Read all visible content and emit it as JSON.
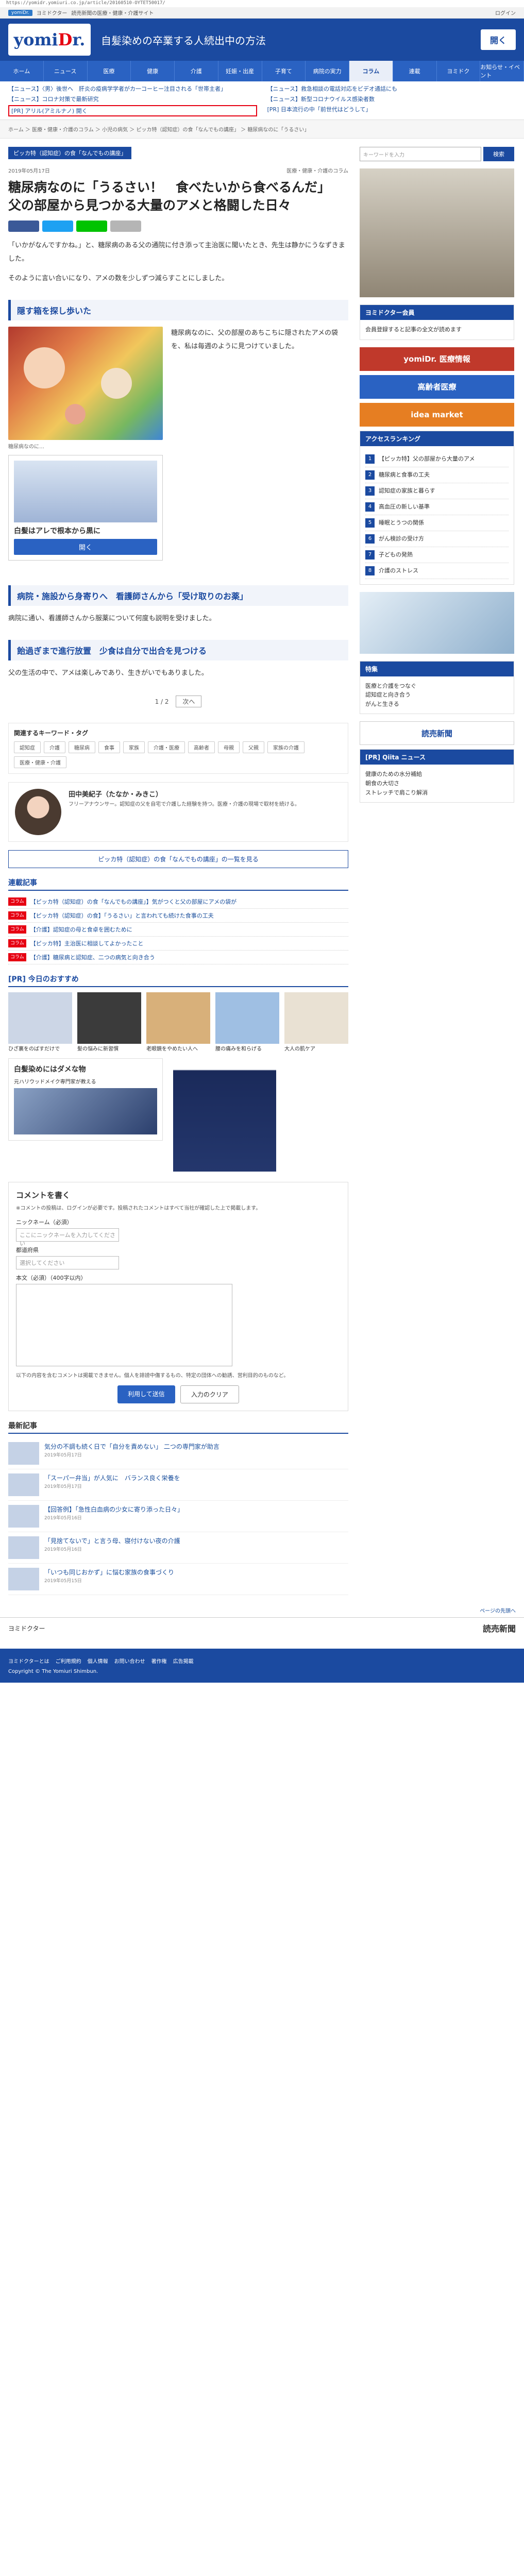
{
  "url": "https://yomidr.yomiuri.co.jp/article/20160510-OYTET50017/",
  "topbar": {
    "items": [
      "yomiDr.",
      "ヨミドクター",
      "読売新聞の医療・健康・介護サイト"
    ],
    "login": "ログイン"
  },
  "header": {
    "subtitle": "自髪染めの卒業する人続出中の方法",
    "button": "開く"
  },
  "nav": [
    "ホーム",
    "ニュース",
    "医療",
    "健康",
    "介護",
    "妊娠・出産",
    "子育て",
    "病院の実力",
    "コラム",
    "連載",
    "ヨミドク",
    "お知らせ・イベント"
  ],
  "news": [
    "【ニュース】〈男〉後世へ　肝炎の疫病学学者がカ一コーヒー注目される「世帯主者」",
    "【ニュース】救急相談の電話対応をビデオ通話にも",
    "【ニュース】コロナ対策で最新研究",
    "【ニュース】新型コロナウイルス感染者数",
    "[PR] アリル(アミルナノ) 開く",
    "[PR] 日本流行の中「前世代はどうして」"
  ],
  "breadcrumb": "ホーム ＞ 医療・健康・介護のコラム ＞ 小児の病気 ＞ ピッカ特（認知症）の食「なんでもの講座」 ＞ 糖尿病なのに「うるさい」",
  "article": {
    "category": "ピッカ特（認知症）の食「なんでもの講座」",
    "date": "2019年05月17日",
    "tags": "医療・健康・介護のコラム",
    "title": "糖尿病なのに「うるさい！　食べたいから食べるんだ」　父の部屋から見つかる大量のアメと格闘した日々",
    "paragraphs": [
      "「いかがなんですかね。」と、糖尿病のある父の通院に付き添って主治医に聞いたとき、先生は静かにうなずきました。",
      "そのように言い合いになり、アメの数を少しずつ減らすことにしました。"
    ],
    "sections": [
      {
        "heading": "隠す箱を探し歩いた",
        "text": "糖尿病なのに、父の部屋のあちこちに隠されたアメの袋を、私は毎週のように見つけていました。"
      },
      {
        "heading": "病院・施設から身寄りへ　看護師さんから「受け取りのお薬」",
        "text": "病院に通い、看護師さんから服薬について何度も説明を受けました。"
      },
      {
        "heading": "飴過ぎまで進行放置　少食は自分で出合を見つける",
        "text": "父の生活の中で、アメは楽しみであり、生きがいでもありました。"
      }
    ],
    "image_caption": "糖尿病なのに…",
    "ad": {
      "title": "白髪はアレで根本から黒に",
      "button": "開く"
    },
    "pager": "1 / 2",
    "next": "次へ"
  },
  "tags": {
    "heading": "関連するキーワード・タグ",
    "items": [
      "認知症",
      "介護",
      "糖尿病",
      "食事",
      "家族",
      "介護・医療",
      "高齢者",
      "母親",
      "父親",
      "家族の介護",
      "医療・健康・介護"
    ]
  },
  "author": {
    "name": "田中美紀子（たなか・みきこ）",
    "desc": "フリーアナウンサー。認知症の父を自宅で介護した経験を持つ。医療・介護の現場で取材を続ける。"
  },
  "more_button": "ピッカ特（認知症）の食「なんでもの講座」の一覧を見る",
  "related": {
    "heading": "連載記事",
    "items": [
      {
        "tag": "コラム",
        "text": "【ピッカ特（認知症）の食「なんでもの講座」】気がつくと父の部屋にアメの袋が"
      },
      {
        "tag": "コラム",
        "text": "【ピッカ特（認知症）の食】「うるさい」と言われても続けた食事の工夫"
      },
      {
        "tag": "コラム",
        "text": "【介護】認知症の母と食卓を囲むために"
      },
      {
        "tag": "コラム",
        "text": "【ピッカ特】主治医に相談してよかったこと"
      },
      {
        "tag": "コラム",
        "text": "【介護】糖尿病と認知症、二つの病気と向き合う"
      }
    ]
  },
  "pr": {
    "heading": "[PR] 今日のおすすめ",
    "items": [
      "ひざ裏をのばすだけで",
      "髪の悩みに新習慣",
      "老眼鏡をやめたい人へ",
      "腰の痛みを和らげる",
      "大人の肌ケア"
    ]
  },
  "ad_boxes": [
    {
      "title": "白髪染めにはダメな物",
      "desc": "元ハリウッドメイク専門家が教える"
    },
    {
      "title": "",
      "desc": ""
    }
  ],
  "comment": {
    "heading": "コメントを書く",
    "note": "※コメントの投稿は、ログインが必要です。投稿されたコメントはすべて当社が確認した上で掲載します。",
    "name_label": "ニックネーム（必須）",
    "name_placeholder": "ここにニックネームを入力してください",
    "region_label": "都道府県",
    "region_placeholder": "選択してください",
    "body_label": "本文（必須）（400字以内）",
    "rules": "以下の内容を含むコメントは掲載できません。個人を誹謗中傷するもの、特定の団体への勧誘、営利目的のものなど。",
    "submit": "利用して送信",
    "cancel": "入力のクリア"
  },
  "latest": {
    "heading": "最新記事",
    "items": [
      {
        "text": "気分の不調も続く日で「自分を責めない」 二つの専門家が助言",
        "date": "2019年05月17日"
      },
      {
        "text": "「スーパー弁当」が人気に　バランス良く栄養を",
        "date": "2019年05月17日"
      },
      {
        "text": "【回答例】「急性白血病の少女に寄り添った日々」",
        "date": "2019年05月16日"
      },
      {
        "text": "「見捨てないで」と言う母、寝付けない夜の介護",
        "date": "2019年05月16日"
      },
      {
        "text": "「いつも同じおかず」に悩む家族の食事づくり",
        "date": "2019年05月15日"
      }
    ]
  },
  "sidebar": {
    "search_placeholder": "キーワードを入力",
    "search_button": "検索",
    "login": {
      "heading": "ヨミドクター会員",
      "text": "会員登録すると記事の全文が読めます"
    },
    "banners": [
      "yomiDr. 医療情報",
      "高齢者医療",
      "idea market"
    ],
    "access": {
      "heading": "アクセスランキング",
      "items": [
        "【ピッカ特】父の部屋から大量のアメ",
        "糖尿病と食事の工夫",
        "認知症の家族と暮らす",
        "高血圧の新しい基準",
        "睡眠とうつの関係",
        "がん検診の受け方",
        "子どもの発熱",
        "介護のストレス"
      ]
    },
    "special": {
      "heading": "特集",
      "items": [
        "医療と介護をつなぐ",
        "認知症と向き合う",
        "がんと生きる"
      ]
    },
    "yomiuri": "読売新聞",
    "ranking2": {
      "heading": "[PR] Qiita ニュース",
      "items": [
        "健康のための水分補給",
        "朝食の大切さ",
        "ストレッチで肩こり解消"
      ]
    }
  },
  "footer": {
    "links": [
      "ヨミドクターとは",
      "ご利用規約",
      "個人情報",
      "お問い合わせ",
      "著作権",
      "広告掲載"
    ],
    "copy": "Copyright © The Yomiuri Shimbun."
  },
  "pagetop": "ページの先頭へ",
  "yomiuri_footer": {
    "left": "ヨミドクター",
    "right": "読売新聞"
  }
}
